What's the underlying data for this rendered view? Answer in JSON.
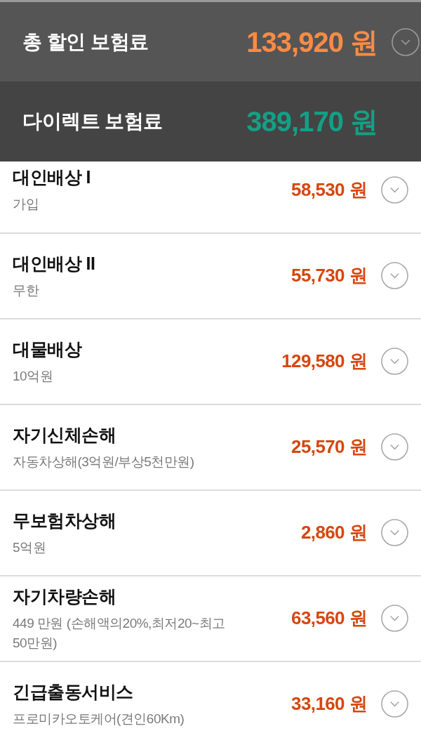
{
  "summary": [
    {
      "label": "총 할인 보험료",
      "amount": "133,920 원",
      "color": "#f98b45",
      "expandable": true
    },
    {
      "label": "다이렉트 보험료",
      "amount": "389,170 원",
      "color": "#14a085",
      "expandable": false
    }
  ],
  "coverages": [
    {
      "title": "대인배상 I",
      "detail": "가입",
      "amount": "58,530 원",
      "expandable": true
    },
    {
      "title": "대인배상 II",
      "detail": "무한",
      "amount": "55,730 원",
      "expandable": true
    },
    {
      "title": "대물배상",
      "detail": "10억원",
      "amount": "129,580 원",
      "expandable": true
    },
    {
      "title": "자기신체손해",
      "detail": "자동차상해(3억원/부상5천만원)",
      "amount": "25,570 원",
      "expandable": true
    },
    {
      "title": "무보험차상해",
      "detail": "5억원",
      "amount": "2,860 원",
      "expandable": true
    },
    {
      "title": "자기차량손해",
      "detail": "449 만원 (손해액의20%,최저20~최고50만원)",
      "amount": "63,560 원",
      "expandable": true
    },
    {
      "title": "긴급출동서비스",
      "detail": "프로미카오토케어(견인60Km)",
      "amount": "33,160 원",
      "expandable": true
    }
  ]
}
